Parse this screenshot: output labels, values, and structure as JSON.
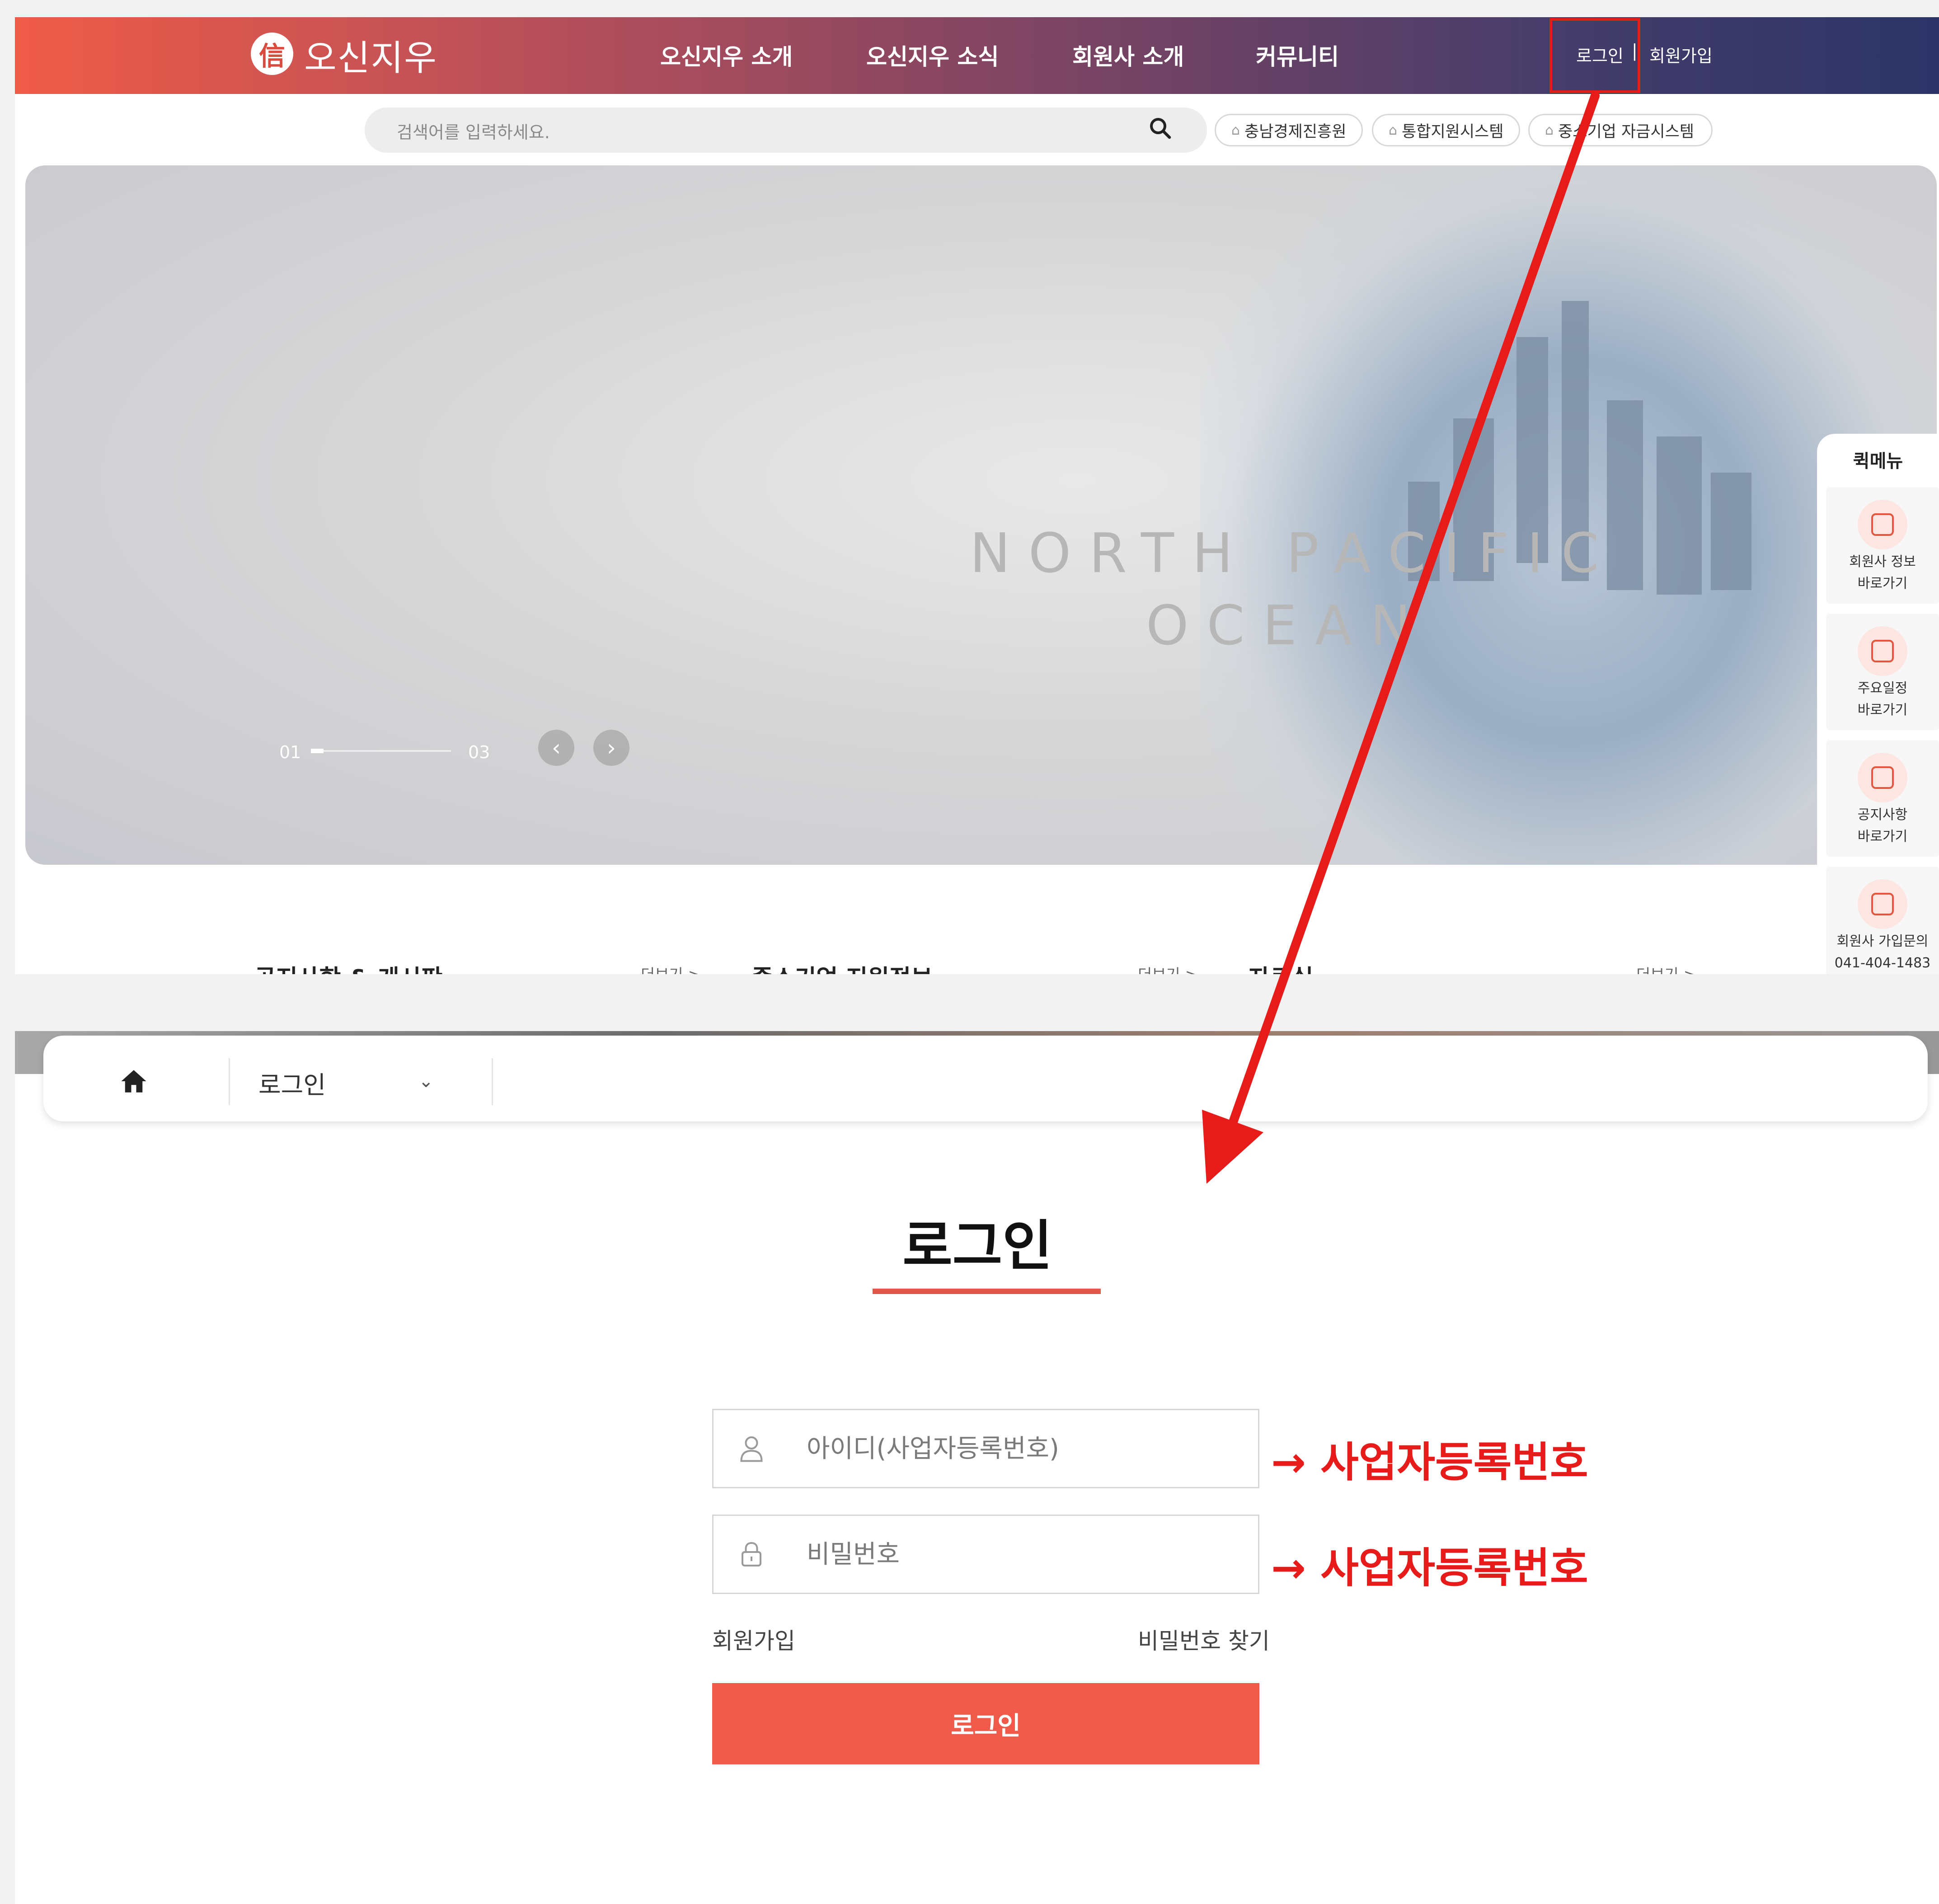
{
  "top": {
    "logo": {
      "mark": "信",
      "text": "오신지우"
    },
    "nav": [
      "오신지우 소개",
      "오신지우 소식",
      "회원사 소개",
      "커뮤니티"
    ],
    "util": {
      "login": "로그인",
      "separator": "|",
      "join": "회원가입"
    },
    "search": {
      "placeholder": "검색어를 입력하세요."
    },
    "shortcuts": [
      "충남경제진흥원",
      "통합지원시스템",
      "중소기업 자금시스템"
    ],
    "hero": {
      "ocean_line1": "NORTH PACIFIC",
      "ocean_line2": "OCEAN"
    },
    "slider": {
      "current": "01",
      "total": "03",
      "progress": 0.09
    },
    "quick_menu": {
      "title": "퀵메뉴",
      "items": [
        {
          "line1": "회원사 정보",
          "line2": "바로가기",
          "icon": "member-search-icon"
        },
        {
          "line1": "주요일정",
          "line2": "바로가기",
          "icon": "calendar-icon"
        },
        {
          "line1": "공지사항",
          "line2": "바로가기",
          "icon": "notice-icon"
        },
        {
          "line1": "회원사 가입문의",
          "line2": "041-404-1483",
          "icon": "meeting-icon"
        }
      ]
    },
    "sections": [
      {
        "title": "공지사항 & 게시판",
        "more": "더보기 >"
      },
      {
        "title": "중소기업 지원정보",
        "more": "더보기 >"
      },
      {
        "title": "자료실",
        "more": "더보기 >"
      }
    ]
  },
  "bottom": {
    "breadcrumb": {
      "current": "로그인"
    },
    "title": "로그인",
    "id_field": {
      "placeholder": "아이디(사업자등록번호)",
      "value": ""
    },
    "pw_field": {
      "placeholder": "비밀번호",
      "value": ""
    },
    "annotations": [
      "→ 사업자등록번호",
      "→ 사업자등록번호"
    ],
    "links": {
      "join": "회원가입",
      "find_password": "비밀번호 찾기"
    },
    "submit": "로그인"
  },
  "colors": {
    "accent": "#ef5a4a",
    "annotation": "#e81b1b",
    "header_start": "#ef5b47",
    "header_end": "#2c3467"
  }
}
